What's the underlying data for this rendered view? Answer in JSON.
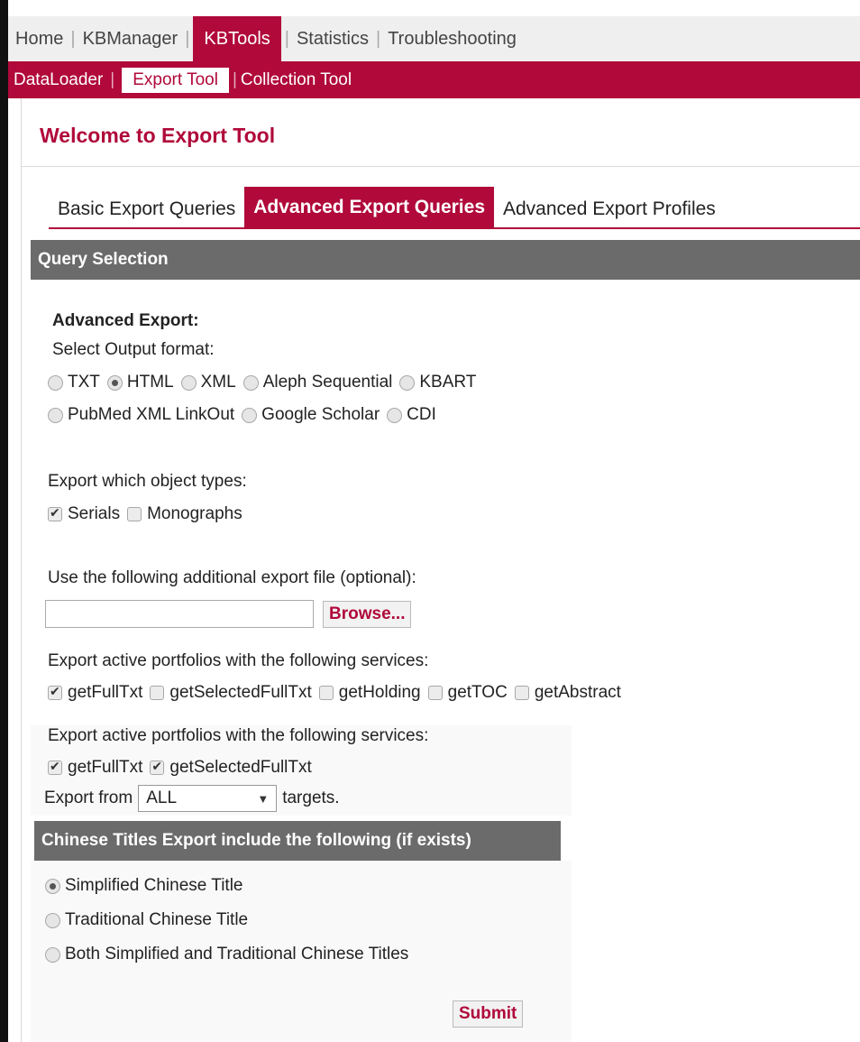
{
  "nav": {
    "items": [
      "Home",
      "KBManager",
      "KBTools",
      "Statistics",
      "Troubleshooting"
    ],
    "active": "KBTools"
  },
  "subnav": {
    "items": [
      "DataLoader",
      "Export Tool",
      "Collection Tool"
    ],
    "active": "Export Tool"
  },
  "page": {
    "title": "Welcome to Export Tool"
  },
  "tabs": [
    "Basic Export Queries",
    "Advanced Export Queries",
    "Advanced Export Profiles"
  ],
  "section": {
    "title": "Query Selection"
  },
  "form": {
    "heading": "Advanced Export:",
    "output_label": "Select Output format:",
    "formats": [
      "TXT",
      "HTML",
      "XML",
      "Aleph Sequential",
      "KBART",
      "PubMed XML LinkOut",
      "Google Scholar",
      "CDI"
    ],
    "selected_format": "HTML",
    "object_types_label": "Export which object types:",
    "object_types": [
      "Serials",
      "Monographs"
    ],
    "object_types_checked": [
      "Serials"
    ],
    "file_label": "Use the following additional export file (optional):",
    "file_value": "",
    "browse_label": "Browse...",
    "services_label_1": "Export active portfolios with the following services:",
    "services_1": [
      "getFullTxt",
      "getSelectedFullTxt",
      "getHolding",
      "getTOC",
      "getAbstract"
    ],
    "services_1_checked": [
      "getFullTxt"
    ],
    "services_label_2": "Export active portfolios with the following services:",
    "services_2": [
      "getFullTxt",
      "getSelectedFullTxt"
    ],
    "services_2_checked": [
      "getFullTxt",
      "getSelectedFullTxt"
    ],
    "export_from_label": "Export from",
    "export_from_value": "ALL",
    "targets_label": "targets.",
    "chinese_title": "Chinese Titles Export include the following (if exists)",
    "chinese_options": [
      "Simplified Chinese Title",
      "Traditional Chinese Title",
      "Both Simplified and Traditional Chinese Titles"
    ],
    "chinese_selected": "Simplified Chinese Title",
    "submit_label": "Submit"
  }
}
